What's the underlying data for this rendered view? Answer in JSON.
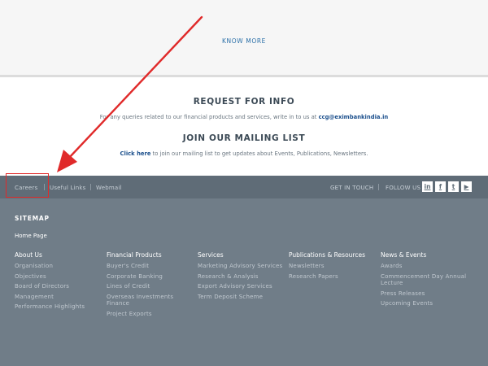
{
  "top": {
    "know_more": "KNOW MORE"
  },
  "request": {
    "title": "REQUEST FOR INFO",
    "text_before": "For any queries related to our financial products and services, write in to us at ",
    "email": "ccg@eximbankindia.in"
  },
  "mailing": {
    "title": "JOIN OUR MAILING LIST",
    "link": "Click here",
    "text_after": " to join our mailing list to get updates about Events, Publications, Newsletters."
  },
  "bar": {
    "links": [
      "Careers",
      "Useful Links",
      "Webmail"
    ],
    "get_in_touch": "GET IN TOUCH",
    "follow_us": "FOLLOW US",
    "social": [
      {
        "icon": "linkedin-icon",
        "glyph": "in"
      },
      {
        "icon": "facebook-icon",
        "glyph": "f"
      },
      {
        "icon": "twitter-icon",
        "glyph": "t"
      },
      {
        "icon": "youtube-icon",
        "glyph": "▶"
      }
    ]
  },
  "sitemap": {
    "title": "SITEMAP",
    "home": "Home Page",
    "columns": [
      {
        "heading": "About Us",
        "items": [
          "Organisation",
          "Objectives",
          "Board of Directors",
          "Management",
          "Performance Highlights"
        ]
      },
      {
        "heading": "Financial Products",
        "items": [
          "Buyer's Credit",
          "Corporate Banking",
          "Lines of Credit",
          "Overseas Investments Finance",
          "Project Exports"
        ]
      },
      {
        "heading": "Services",
        "items": [
          "Marketing Advisory Services",
          "Research & Analysis",
          "Export Advisory Services",
          "Term Deposit Scheme"
        ]
      },
      {
        "heading": "Publications & Resources",
        "items": [
          "Newsletters",
          "Research Papers"
        ]
      },
      {
        "heading": "News & Events",
        "items": [
          "Awards",
          "Commencement Day Annual Lecture",
          "Press Releases",
          "Upcoming Events"
        ]
      }
    ]
  },
  "colors": {
    "annotation": "#e02a2a",
    "footer_bar": "#5f6c77",
    "footer_main": "#707d88",
    "link": "#1b4f8c"
  }
}
